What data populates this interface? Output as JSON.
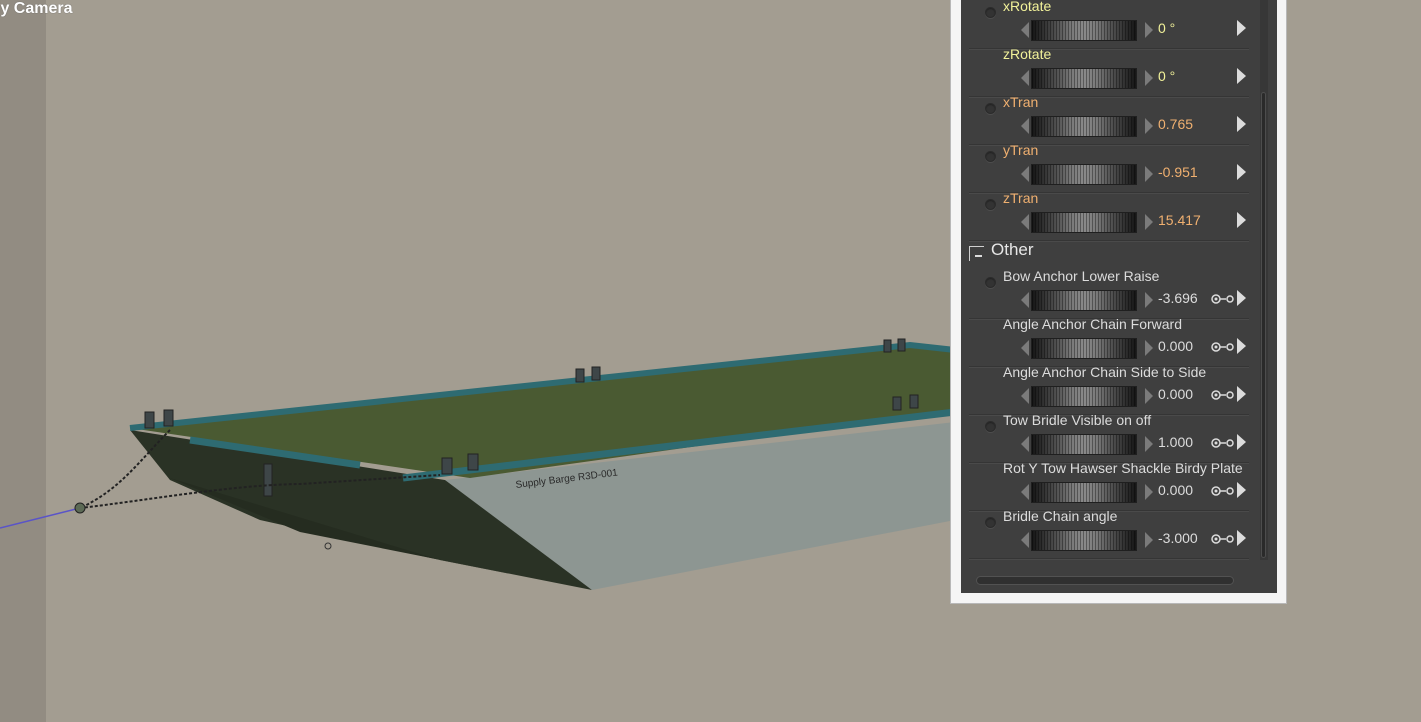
{
  "viewport": {
    "camera_label": "ly Camera",
    "model_label": "Supply Barge  R3D-001"
  },
  "parameters_transform": [
    {
      "name": "xRotate",
      "value": "0 °",
      "name_color": "#f2f29a",
      "value_color": "#f2f29a"
    },
    {
      "name": "zRotate",
      "value": "0 °",
      "name_color": "#f2f29a",
      "value_color": "#f2f29a"
    },
    {
      "name": "xTran",
      "value": "0.765",
      "name_color": "#f0b070",
      "value_color": "#f0b070"
    },
    {
      "name": "yTran",
      "value": "-0.951",
      "name_color": "#f0b070",
      "value_color": "#f0b070"
    },
    {
      "name": "zTran",
      "value": "15.417",
      "name_color": "#f0b070",
      "value_color": "#f0b070"
    }
  ],
  "group_other": {
    "title": "Other"
  },
  "parameters_other": [
    {
      "name": "Bow Anchor Lower Raise",
      "value": "-3.696",
      "has_radio": true
    },
    {
      "name": "Angle Anchor Chain Forward",
      "value": "0.000",
      "has_radio": false
    },
    {
      "name": "Angle Anchor Chain Side  to Side",
      "value": "0.000",
      "has_radio": false
    },
    {
      "name": "Tow Bridle Visible on off",
      "value": "1.000",
      "has_radio": true
    },
    {
      "name": "Rot Y Tow Hawser Shackle Birdy Plate",
      "value": "0.000",
      "has_radio": false
    },
    {
      "name": "Bridle Chain angle",
      "value": "-3.000",
      "has_radio": true
    }
  ],
  "colors": {
    "background": "#a39d91",
    "panel": "#3f3f3f",
    "deck": "#4a5a32",
    "hull": "#8a9390"
  }
}
